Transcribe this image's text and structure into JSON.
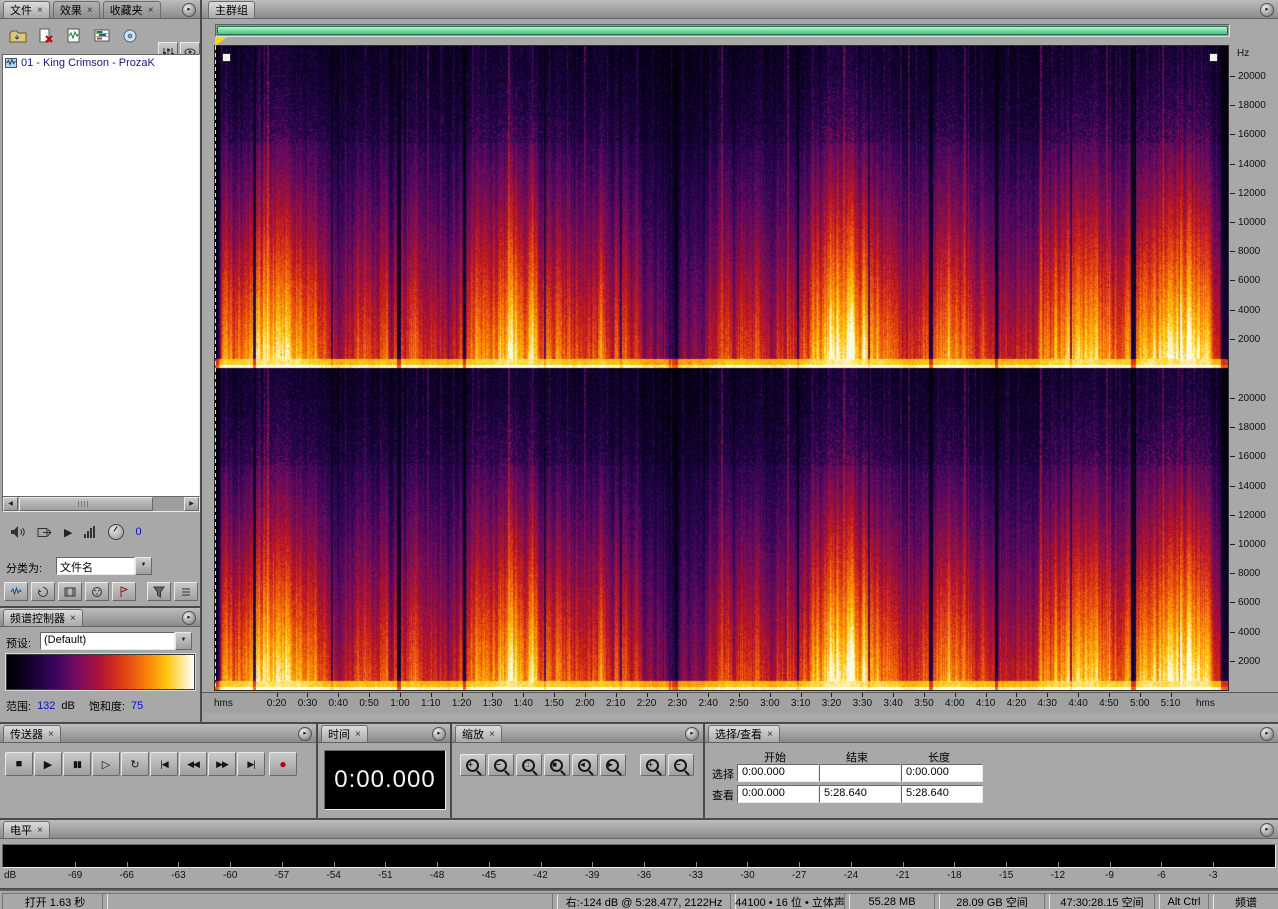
{
  "colors": {
    "accent_green": "#6fd49c",
    "record_red": "#b40000",
    "value_blue": "#0012c8",
    "playhead_yellow": "#ffd800"
  },
  "icons": {
    "panel_menu": "▸",
    "down": "▼",
    "left": "◀",
    "right": "▶",
    "play": "▶"
  },
  "files_panel": {
    "tabs": [
      {
        "label": "文件",
        "close": "×"
      },
      {
        "label": "效果",
        "close": "×"
      },
      {
        "label": "收藏夹",
        "close": "×"
      }
    ],
    "toolbar_icons": [
      "import-file",
      "close-file",
      "edit-file",
      "insert-into-multitrack",
      "insert-into-cd",
      "advanced-options",
      "display-options"
    ],
    "file_list": [
      {
        "name": "01 - King Crimson - ProzaK",
        "icon": "audio-file"
      }
    ],
    "preview": {
      "volume": "0"
    },
    "sort": {
      "label": "分类为:",
      "value": "文件名"
    },
    "filter_buttons": [
      "show-audio-files",
      "show-loop-files",
      "show-video-files",
      "show-midi-files",
      "show-markers",
      "filter",
      "options"
    ]
  },
  "spectral_panel": {
    "title": "频谱控制器",
    "close": "×",
    "preset_label": "预设:",
    "preset_value": "(Default)",
    "range_label": "范围:",
    "range_value": "132",
    "range_unit": "dB",
    "saturation_label": "饱和度:",
    "saturation_value": "75"
  },
  "main_panel": {
    "tab": "主群组",
    "freq_unit": "Hz",
    "time_unit": "hms",
    "max_freq_hz": 22050,
    "duration_s": 328.64,
    "freq_ticks": [
      "20000",
      "18000",
      "16000",
      "14000",
      "12000",
      "10000",
      "8000",
      "6000",
      "4000",
      "2000"
    ],
    "time_ticks": [
      "0:20",
      "0:30",
      "0:40",
      "0:50",
      "1:00",
      "1:10",
      "1:20",
      "1:30",
      "1:40",
      "1:50",
      "2:00",
      "2:10",
      "2:20",
      "2:30",
      "2:40",
      "2:50",
      "3:00",
      "3:10",
      "3:20",
      "3:30",
      "3:40",
      "3:50",
      "4:00",
      "4:10",
      "4:20",
      "4:30",
      "4:40",
      "4:50",
      "5:00",
      "5:10"
    ]
  },
  "spectrogram": {
    "channels": 2,
    "seed": 911,
    "palette": [
      [
        0.0,
        "#000004"
      ],
      [
        0.1,
        "#10022e"
      ],
      [
        0.2,
        "#2a0650"
      ],
      [
        0.3,
        "#5a0a62"
      ],
      [
        0.42,
        "#8f1048"
      ],
      [
        0.52,
        "#c01820"
      ],
      [
        0.64,
        "#e84a10"
      ],
      [
        0.76,
        "#f98908"
      ],
      [
        0.88,
        "#ffcf10"
      ],
      [
        1.0,
        "#fffbe0"
      ]
    ],
    "gaps": [
      [
        0.038,
        3,
        0.25
      ],
      [
        0.115,
        2,
        0.5
      ],
      [
        0.18,
        4,
        0.2
      ],
      [
        0.245,
        3,
        0.3
      ],
      [
        0.325,
        2,
        0.45
      ],
      [
        0.4,
        2,
        0.5
      ],
      [
        0.455,
        3,
        0.35
      ],
      [
        0.575,
        2,
        0.5
      ],
      [
        0.645,
        2,
        0.55
      ],
      [
        0.705,
        4,
        0.25
      ],
      [
        0.77,
        3,
        0.3
      ],
      [
        0.845,
        2,
        0.5
      ],
      [
        0.905,
        5,
        0.2
      ]
    ],
    "transients": [
      0.052,
      0.21,
      0.29,
      0.365,
      0.5,
      0.565,
      0.62,
      0.685,
      0.74,
      0.815,
      0.88,
      0.935
    ]
  },
  "transport_panel": {
    "title": "传送器",
    "close": "×",
    "buttons": [
      {
        "name": "stop",
        "glyph": "■"
      },
      {
        "name": "play",
        "glyph": "▶"
      },
      {
        "name": "pause",
        "glyph": "▮▮"
      },
      {
        "name": "play-from-cursor",
        "glyph": "▷"
      },
      {
        "name": "play-looped",
        "glyph": "↻"
      },
      {
        "name": "go-to-beginning",
        "glyph": "|◀"
      },
      {
        "name": "rewind",
        "glyph": "◀◀"
      },
      {
        "name": "fast-forward",
        "glyph": "▶▶"
      },
      {
        "name": "go-to-end",
        "glyph": "▶|"
      },
      {
        "name": "record",
        "glyph": "●"
      }
    ]
  },
  "time_panel": {
    "title": "时间",
    "close": "×",
    "value": "0:00.000"
  },
  "zoom_panel": {
    "title": "缩放",
    "close": "×",
    "buttons": [
      {
        "name": "zoom-in-horizontal",
        "glyph": "+"
      },
      {
        "name": "zoom-out-horizontal",
        "glyph": "−"
      },
      {
        "name": "zoom-out-full",
        "glyph": "□"
      },
      {
        "name": "zoom-to-selection",
        "glyph": "■"
      },
      {
        "name": "zoom-left-edge",
        "glyph": "◄"
      },
      {
        "name": "zoom-right-edge",
        "glyph": "►"
      },
      {
        "name": "zoom-in-vertical",
        "glyph": "+"
      },
      {
        "name": "zoom-out-vertical",
        "glyph": "−"
      }
    ]
  },
  "selview_panel": {
    "title": "选择/查看",
    "close": "×",
    "columns": [
      "开始",
      "结束",
      "长度"
    ],
    "rows": [
      {
        "label": "选择",
        "start": "0:00.000",
        "end": "",
        "length": "0:00.000"
      },
      {
        "label": "查看",
        "start": "0:00.000",
        "end": "5:28.640",
        "length": "5:28.640"
      }
    ]
  },
  "levels_panel": {
    "title": "电平",
    "close": "×",
    "unit": "dB",
    "ticks": [
      "-69",
      "-66",
      "-63",
      "-60",
      "-57",
      "-54",
      "-51",
      "-48",
      "-45",
      "-42",
      "-39",
      "-36",
      "-33",
      "-30",
      "-27",
      "-24",
      "-21",
      "-18",
      "-15",
      "-12",
      "-9",
      "-6",
      "-3"
    ]
  },
  "status_bar": {
    "items": [
      {
        "name": "open-status",
        "text": "打开 1.63 秒"
      },
      {
        "name": "message-area",
        "text": ""
      },
      {
        "name": "cursor-info",
        "text": "右:-124 dB @ 5:28.477, 2122Hz"
      },
      {
        "name": "format-info",
        "text": "44100 • 16 位 • 立体声"
      },
      {
        "name": "file-size",
        "text": "55.28 MB"
      },
      {
        "name": "free-space",
        "text": "28.09 GB 空间"
      },
      {
        "name": "free-time",
        "text": "47:30:28.15 空间"
      },
      {
        "name": "modifier-keys",
        "text": "Alt Ctrl"
      },
      {
        "name": "view-mode",
        "text": "频谱"
      }
    ]
  }
}
